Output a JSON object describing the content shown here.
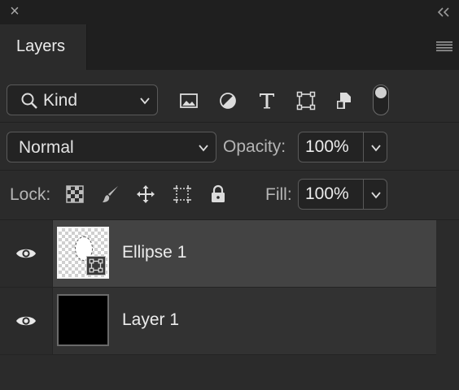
{
  "panel": {
    "tab_title": "Layers",
    "icons": {
      "close": "close-icon",
      "collapse": "double-chevron-left-icon",
      "menu": "panel-menu-icon"
    }
  },
  "filter": {
    "kind_label": "Kind",
    "icons": [
      "image-filter-icon",
      "adjustment-filter-icon",
      "type-filter-icon",
      "shape-filter-icon",
      "smart-object-filter-icon"
    ],
    "toggle_on": true
  },
  "blend": {
    "mode": "Normal",
    "opacity_label": "Opacity:",
    "opacity_value": "100%"
  },
  "lock": {
    "label": "Lock:",
    "icons": [
      "lock-transparent-pixels-icon",
      "lock-image-pixels-icon",
      "lock-position-icon",
      "lock-artboard-icon",
      "lock-all-icon"
    ],
    "fill_label": "Fill:",
    "fill_value": "100%"
  },
  "layers": [
    {
      "name": "Ellipse 1",
      "visible": true,
      "selected": true,
      "thumbnail": "transparent-with-ellipse"
    },
    {
      "name": "Layer 1",
      "visible": true,
      "selected": false,
      "thumbnail": "black"
    }
  ],
  "colors": {
    "panel_bg": "#2b2b2b",
    "selected_row": "#434343",
    "text": "#ececec"
  }
}
